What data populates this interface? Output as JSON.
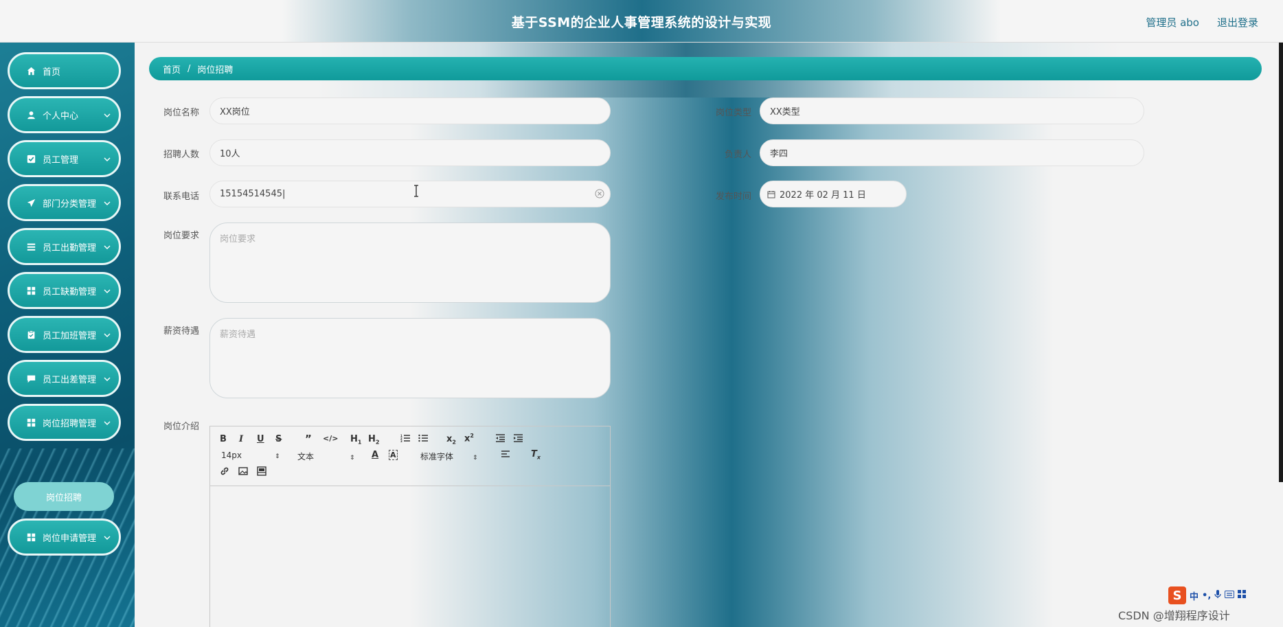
{
  "header": {
    "title": "基于SSM的企业人事管理系统的设计与实现",
    "user": "管理员 abo",
    "logout": "退出登录"
  },
  "sidebar": {
    "items": [
      {
        "label": "首页",
        "icon": "home-icon"
      },
      {
        "label": "个人中心",
        "icon": "user-icon"
      },
      {
        "label": "员工管理",
        "icon": "checkbox-icon"
      },
      {
        "label": "部门分类管理",
        "icon": "send-icon"
      },
      {
        "label": "员工出勤管理",
        "icon": "list-icon"
      },
      {
        "label": "员工缺勤管理",
        "icon": "grid-icon"
      },
      {
        "label": "员工加班管理",
        "icon": "clipboard-icon"
      },
      {
        "label": "员工出差管理",
        "icon": "chat-icon"
      },
      {
        "label": "岗位招聘管理",
        "icon": "grid-icon"
      },
      {
        "label": "岗位申请管理",
        "icon": "grid-icon"
      }
    ],
    "submenu_active": "岗位招聘"
  },
  "breadcrumb": {
    "home": "首页",
    "separator": "/",
    "current": "岗位招聘"
  },
  "form": {
    "job_name": {
      "label": "岗位名称",
      "value": "XX岗位"
    },
    "job_type": {
      "label": "岗位类型",
      "value": "XX类型"
    },
    "headcount": {
      "label": "招聘人数",
      "value": "10人"
    },
    "manager": {
      "label": "负责人",
      "value": "李四"
    },
    "phone": {
      "label": "联系电话",
      "value": "15154514545"
    },
    "publish_date": {
      "label": "发布时间",
      "value": "2022 年 02 月 11 日"
    },
    "requirements": {
      "label": "岗位要求",
      "placeholder": "岗位要求"
    },
    "salary": {
      "label": "薪资待遇",
      "placeholder": "薪资待遇"
    },
    "intro": {
      "label": "岗位介绍"
    }
  },
  "editor": {
    "font_size": "14px",
    "text_type": "文本",
    "font_family": "标准字体"
  },
  "ime": {
    "lang": "中"
  },
  "watermark": "CSDN @增翔程序设计",
  "colors": {
    "accent": "#13999a",
    "header_text": "#1f6f8a"
  }
}
